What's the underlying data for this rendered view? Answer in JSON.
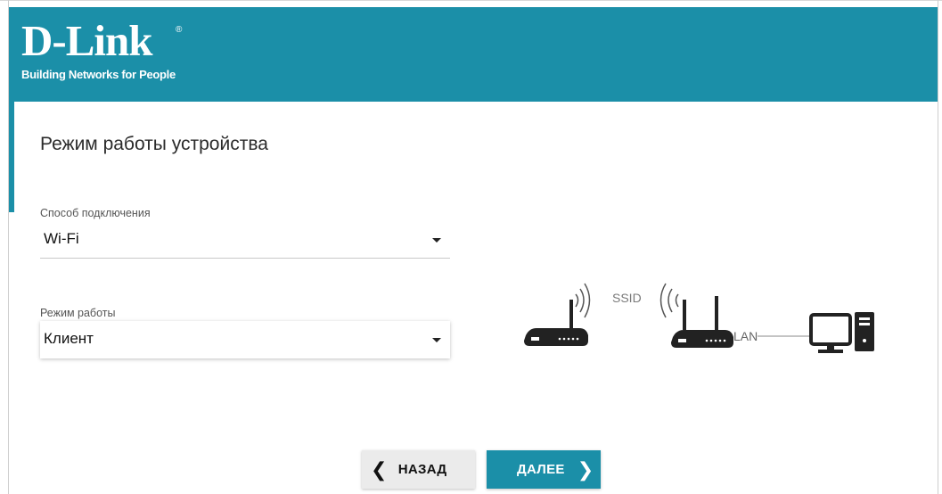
{
  "brand": {
    "name": "D-Link",
    "registered_mark": "®",
    "tagline": "Building Networks for People",
    "color": "#1b8fa8"
  },
  "page": {
    "title": "Режим работы устройства"
  },
  "form": {
    "connection": {
      "label": "Способ подключения",
      "value": "Wi-Fi"
    },
    "mode": {
      "label": "Режим работы",
      "value": "Клиент"
    }
  },
  "diagram": {
    "ssid_label": "SSID",
    "lan_label": "LAN",
    "icons": [
      "router-icon",
      "wifi-waves-icon",
      "router-icon",
      "computer-icon"
    ]
  },
  "buttons": {
    "back": {
      "label": "НАЗАД",
      "icon": "chevron-left-icon"
    },
    "next": {
      "label": "ДАЛЕЕ",
      "icon": "chevron-right-icon"
    }
  }
}
